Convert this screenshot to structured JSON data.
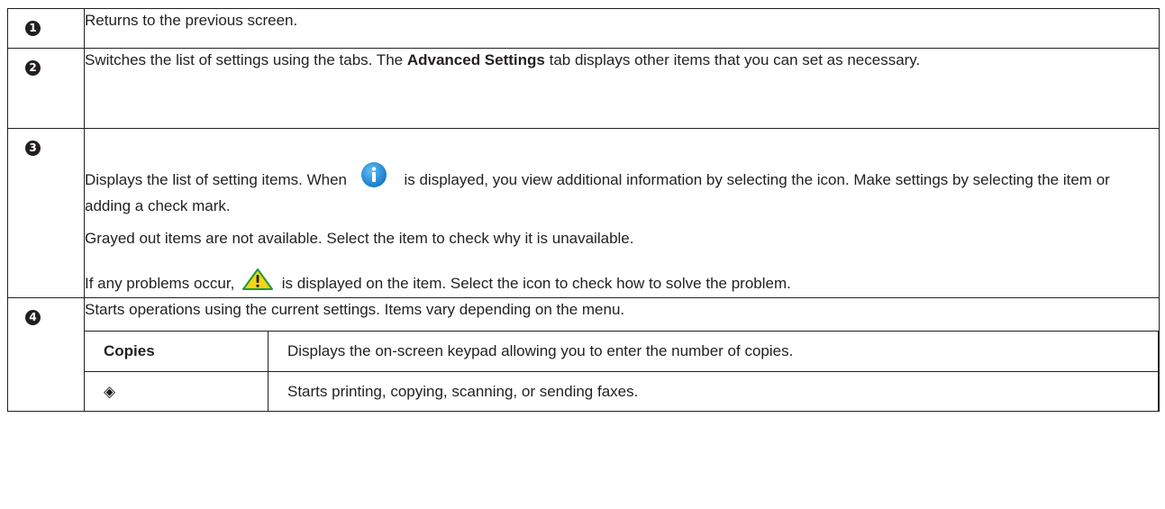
{
  "rows": [
    {
      "marker": "1",
      "text": "Returns to the previous screen."
    },
    {
      "marker": "2",
      "text_pre": "Switches the list of settings using the tabs. The ",
      "bold": "Advanced Settings",
      "text_post": " tab displays other items that you can set as necessary."
    },
    {
      "marker": "3",
      "p1_pre": "Displays the list of setting items. When ",
      "p1_post": " is displayed, you view additional information by selecting the icon. Make settings by selecting the item or adding a check mark.",
      "p2": "Grayed out items are not available. Select the item to check why it is unavailable.",
      "p3_pre": "If any problems occur, ",
      "p3_post": " is displayed on the item. Select the icon to check how to solve the problem."
    },
    {
      "marker": "4",
      "text": "Starts operations using the current settings. Items vary depending on the menu.",
      "subrows": [
        {
          "key": "Copies",
          "value": "Displays the on-screen keypad allowing you to enter the number of copies."
        },
        {
          "key": "◈",
          "value": "Starts printing, copying, scanning, or sending faxes."
        }
      ]
    }
  ],
  "icons": {
    "info": "info-icon",
    "warning": "warning-icon",
    "start": "start-icon"
  },
  "colors": {
    "info_blue": "#1e8fd6",
    "warning_yellow": "#f7d417"
  }
}
